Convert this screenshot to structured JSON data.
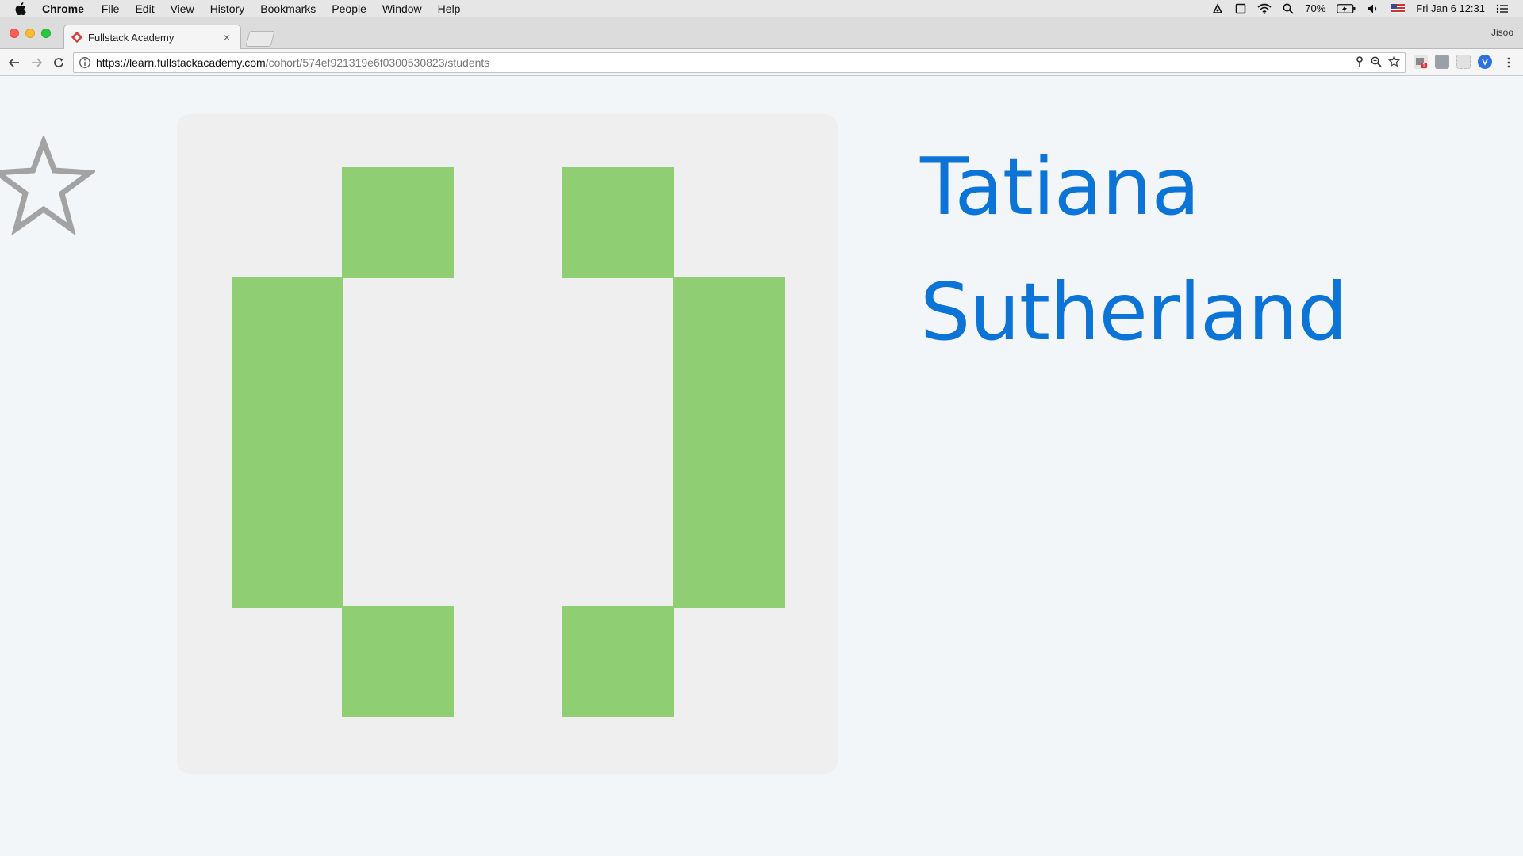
{
  "menubar": {
    "app_name": "Chrome",
    "items": [
      "File",
      "Edit",
      "View",
      "History",
      "Bookmarks",
      "People",
      "Window",
      "Help"
    ],
    "battery": "70%",
    "datetime": "Fri Jan 6  12:31"
  },
  "browser": {
    "tab_title": "Fullstack Academy",
    "tab_close": "×",
    "profile_name": "Jisoo",
    "url_host": "https://learn.fullstackacademy.com",
    "url_path": "/cohort/574ef921319e6f0300530823/students",
    "extension_badge": "1"
  },
  "student": {
    "first_name": "Tatiana",
    "last_name": "Sutherland"
  },
  "colors": {
    "name_color": "#0c74d6",
    "avatar_fill": "#8fce73",
    "avatar_bg": "#efefef",
    "star_stroke": "#a3a3a3"
  },
  "icons": [
    "apple-icon",
    "wifi-icon",
    "search-icon",
    "battery-icon",
    "volume-icon",
    "flag-icon",
    "list-icon",
    "back-icon",
    "forward-icon",
    "reload-icon",
    "info-icon",
    "key-icon",
    "zoom-icon",
    "bookmark-star-icon",
    "star-icon"
  ]
}
